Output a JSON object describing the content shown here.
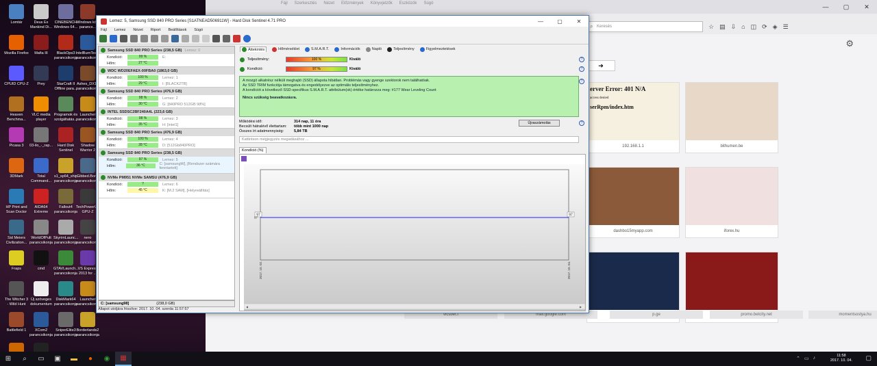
{
  "desktop_icons": [
    {
      "label": "Lomtár",
      "color": "#4a7fc0"
    },
    {
      "label": "Deus Ex Mankind Di...",
      "color": "#c9c9c9"
    },
    {
      "label": "CINEBENCH Windows 64...",
      "color": "#6d6d9e"
    },
    {
      "label": "Windows közi parancs...",
      "color": "#8b3a2a"
    },
    {
      "label": "Mozilla Firefox",
      "color": "#e66000"
    },
    {
      "label": "Mafia III",
      "color": "#8a1c1c"
    },
    {
      "label": "BlackOps3 parancsikonja",
      "color": "#b22a1a"
    },
    {
      "label": "IntelBurnTes... parancsikonja",
      "color": "#2a5a9a"
    },
    {
      "label": "CPUID CPU-Z",
      "color": "#5a5aff"
    },
    {
      "label": "Prey",
      "color": "#333a55"
    },
    {
      "label": "StarCraft II Offline para...",
      "color": "#1d3d6d"
    },
    {
      "label": "Ashes_DX12 parancsikonja",
      "color": "#7a4a2a"
    },
    {
      "label": "Heaven Benchma...",
      "color": "#b07020"
    },
    {
      "label": "VLC media player",
      "color": "#f08c00"
    },
    {
      "label": "Programok és szolgáltatás...",
      "color": "#5a8a5a"
    },
    {
      "label": "Launcher parancsikonja",
      "color": "#c78b1a"
    },
    {
      "label": "Picasa 3",
      "color": "#b33ab3"
    },
    {
      "label": "03-ilo_-_rap...",
      "color": "#777"
    },
    {
      "label": "Hard Disk Sentinel",
      "color": "#aa2222"
    },
    {
      "label": "Shadow Warrior 2",
      "color": "#995522"
    },
    {
      "label": "3DMark",
      "color": "#dd6611"
    },
    {
      "label": "Total Command...",
      "color": "#3a6aca"
    },
    {
      "label": "s1_sp64_ship parancsikonja",
      "color": "#c9a22a"
    },
    {
      "label": "Gibbed.Bor... parancsikonja",
      "color": "#4a6a8a"
    },
    {
      "label": "HP Print and Scan Doctor",
      "color": "#2a7ab5"
    },
    {
      "label": "AIDA64 Extreme",
      "color": "#cc2222"
    },
    {
      "label": "Fallout4 parancsikonja",
      "color": "#7a6a3a"
    },
    {
      "label": "TechPowerUp GPU-Z",
      "color": "#3a3a3a"
    },
    {
      "label": "Sid Meiers Civilization...",
      "color": "#3a6a8a"
    },
    {
      "label": "WorldOfPult parancsikonja",
      "color": "#888"
    },
    {
      "label": "SkyrimLaunc... parancsikonja",
      "color": "#aaa"
    },
    {
      "label": "nero parancsikonja",
      "color": "#444"
    },
    {
      "label": "Fraps",
      "color": "#ddcc22"
    },
    {
      "label": "cmd",
      "color": "#111"
    },
    {
      "label": "GTAVLaunch... parancsikonja",
      "color": "#3a8a3a"
    },
    {
      "label": "VS Express 2013 for ...",
      "color": "#6a3aaa"
    },
    {
      "label": "The Witcher 3 - Wild Hunt",
      "color": "#555"
    },
    {
      "label": "Új szöveges dokumentum",
      "color": "#eee"
    },
    {
      "label": "DiskMark64 parancsikonja",
      "color": "#2a8a8a"
    },
    {
      "label": "Launcher parancsikonja",
      "color": "#c78b1a"
    },
    {
      "label": "Battlefield 1",
      "color": "#9a4a2a"
    },
    {
      "label": "XCom2 parancsikonja",
      "color": "#2a5a9a"
    },
    {
      "label": "SniperElite3 parancsikonja",
      "color": "#6a6a6a"
    },
    {
      "label": "Borderlands2 parancsikonja",
      "color": "#c9a22a"
    },
    {
      "label": "FurMark",
      "color": "#cc6600"
    },
    {
      "label": "ASUS Essence STX II",
      "color": "#222"
    }
  ],
  "browser": {
    "menu": [
      "Fájl",
      "Szerkesztés",
      "Nézet",
      "Előzmények",
      "Könyvjelzők",
      "Eszközök",
      "Súgó"
    ],
    "search_placeholder": "Keresés",
    "tiles": [
      {
        "caption": "192.168.1.1",
        "color": "#f6f0e0"
      },
      {
        "caption": "bithumen.be",
        "color": "#e8d8c8"
      },
      {
        "caption": "dashbo15myapp.com",
        "color": "#8a5a3a"
      },
      {
        "caption": "iforex.hu",
        "color": "#f0e0e0"
      },
      {
        "caption": "promo.betcity.net",
        "color": "#1a2a4a"
      },
      {
        "caption": "momentsostya.hu",
        "color": "#8a1a1a"
      }
    ],
    "bottom_captions": [
      "vicsbet.t",
      "mail.google.com",
      "p.ge",
      "promo.betcity.net",
      "momentsostya.hu"
    ],
    "tile_heading": "erver Error: 401 N/A",
    "tile_sub1": "access denied",
    "tile_sub2": "serRpm/index.htm"
  },
  "hds": {
    "title": "Lemez: 5, Samsung SSD 840 PRO Series [S1ATNEAD506911W]  -  Hard Disk Sentinel 4.71 PRO",
    "menu": [
      "Fájl",
      "Lemez",
      "Nézet",
      "Riport",
      "Beállítások",
      "Súgó"
    ],
    "drives": [
      {
        "name": "Samsung SSD 840 PRO Series",
        "size": "(238,5 GB)",
        "disk": "Lemez: 0",
        "health": "99 %",
        "temp": "27 °C",
        "vol": "E:",
        "vol2": "",
        "temp_warn": false,
        "selected": false
      },
      {
        "name": "WDC WD20EFAEX-00FBA0",
        "size": "(1863,0 GB)",
        "disk": "",
        "health": "100 %",
        "temp": "29 °C",
        "vol": "Lemez: 1",
        "vol2": "I: [BLACK2TB]",
        "temp_warn": false,
        "selected": false
      },
      {
        "name": "Samsung SSD 840 PRO Series",
        "size": "(476,9 GB)",
        "disk": "",
        "health": "98 %",
        "temp": "30 °C",
        "vol": "Lemez: 2",
        "vol2": "G: [840PRO 512GB 98%]",
        "temp_warn": false,
        "selected": false
      },
      {
        "name": "INTEL SSDSC2BF240A4L",
        "size": "(223,6 GB)",
        "disk": "",
        "health": "98 %",
        "temp": "35 °C",
        "vol": "Lemez: 3",
        "vol2": "H: [intel1]",
        "temp_warn": false,
        "selected": false
      },
      {
        "name": "Samsung SSD 840 PRO Series",
        "size": "(476,9 GB)",
        "disk": "",
        "health": "100 %",
        "temp": "28 °C",
        "vol": "Lemez: 4",
        "vol2": "D: [512Gb840PRO]",
        "temp_warn": false,
        "selected": false
      },
      {
        "name": "Samsung SSD 840 PRO Series",
        "size": "(238,5 GB)",
        "disk": "",
        "health": "97 %",
        "temp": "36 °C",
        "vol": "Lemez: 5",
        "vol2": "C: [samsungW], [Rendszer számára fenntartott]",
        "temp_warn": false,
        "selected": true
      },
      {
        "name": "NVMe   PM951 NVMe SAMSU",
        "size": "(476,9 GB)",
        "disk": "",
        "health": "?",
        "temp": "45 °C",
        "vol": "Lemez: 6",
        "vol2": "K: [M.2 SAM], [Helyreállítás]",
        "temp_warn": true,
        "selected": false
      }
    ],
    "labels": {
      "health": "Kondíció:",
      "temp": "Hőm:"
    },
    "left_status_drive": "C: [samsung98]",
    "left_status_size": "(238,0 GB)",
    "status_line": "Állapot utoljára frissítve: 2017. 10. 04. szerda 11:57:57",
    "tabs": [
      "Áttekintés",
      "Hőmérséklet",
      "S.M.A.R.T.",
      "Információk",
      "Napló",
      "Teljesítmény",
      "Figyelmeztetések"
    ],
    "tab_colors": [
      "#2a8a2a",
      "#cc3333",
      "#2a6acc",
      "#2a6acc",
      "#888888",
      "#222222",
      "#2a6acc"
    ],
    "perf_label": "Teljesítmény:",
    "perf_value": "100 %",
    "perf_quality": "Kiváló",
    "health_label": "Kondíció:",
    "health_value": "97 %",
    "health_quality": "Kiváló",
    "info_lines": [
      "A mozgó alkatrész nélküli meghajtó (SSD) állapota hibátlan. Problémás vagy gyenge szektorok nem találhatóak.",
      "Az SSD TRIM funkciója támogatva és engedélyezve az optimális teljesítményhez.",
      "A kondíciót a következő SSD-specifikus S.M.A.R.T. attribútum(ok) értéke határozza meg:  #177 Wear Leveling Count"
    ],
    "info_bold": "Nincs szükség beavatkozásra.",
    "stats": [
      {
        "k": "Működési idő:",
        "v": "314 nap, 11 óra"
      },
      {
        "k": "Becsült hátralévő élettartam:",
        "v": "több mint 1000 nap"
      },
      {
        "k": "Összes írt adatmennyiség:",
        "v": "5,84 TB"
      }
    ],
    "reset_button": "Újraszámolás",
    "comment_placeholder": "Kattintson megjegyzés megadásához ...",
    "chart_tab": "Kondíció  (%)"
  },
  "chart_data": {
    "type": "line",
    "x": [
      "2017. 10. 02.",
      "2017. 10. 04."
    ],
    "values": [
      97,
      97
    ],
    "start_label": "97",
    "end_label": "97",
    "ylabel": "97",
    "color": "#3a3aff"
  },
  "taskbar": {
    "time": "11:58",
    "date": "2017. 10. 04."
  }
}
